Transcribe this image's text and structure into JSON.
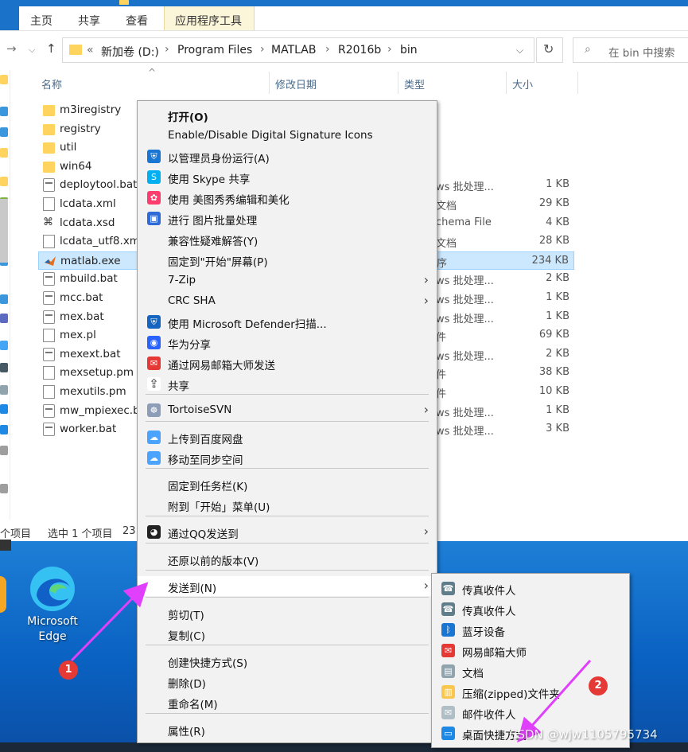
{
  "ribbon": {
    "tabs": [
      "主页",
      "共享",
      "查看"
    ],
    "tools_tab": "应用程序工具"
  },
  "address": {
    "overflow": "«",
    "crumbs": [
      "新加卷 (D:)",
      "Program Files",
      "MATLAB",
      "R2016b",
      "bin"
    ],
    "search_placeholder": "在 bin 中搜索"
  },
  "columns": {
    "name": "名称",
    "date": "修改日期",
    "type": "类型",
    "size": "大小"
  },
  "files": [
    {
      "name": "m3iregistry",
      "type": "",
      "size": "",
      "icon": "folder"
    },
    {
      "name": "registry",
      "type": "",
      "size": "",
      "icon": "folder"
    },
    {
      "name": "util",
      "type": "",
      "size": "",
      "icon": "folder"
    },
    {
      "name": "win64",
      "type": "",
      "size": "",
      "icon": "folder"
    },
    {
      "name": "deploytool.bat",
      "type": "ws 批处理...",
      "size": "1 KB",
      "icon": "bat"
    },
    {
      "name": "lcdata.xml",
      "type": "文档",
      "size": "29 KB",
      "icon": "doc"
    },
    {
      "name": "lcdata.xsd",
      "type": "chema File",
      "size": "4 KB",
      "icon": "xsd"
    },
    {
      "name": "lcdata_utf8.xml",
      "type": "文档",
      "size": "28 KB",
      "icon": "doc"
    },
    {
      "name": "matlab.exe",
      "type": "序",
      "size": "234 KB",
      "icon": "matlab",
      "selected": true
    },
    {
      "name": "mbuild.bat",
      "type": "ws 批处理...",
      "size": "2 KB",
      "icon": "bat"
    },
    {
      "name": "mcc.bat",
      "type": "ws 批处理...",
      "size": "1 KB",
      "icon": "bat"
    },
    {
      "name": "mex.bat",
      "type": "ws 批处理...",
      "size": "1 KB",
      "icon": "bat"
    },
    {
      "name": "mex.pl",
      "type": "件",
      "size": "69 KB",
      "icon": "doc"
    },
    {
      "name": "mexext.bat",
      "type": "ws 批处理...",
      "size": "2 KB",
      "icon": "bat"
    },
    {
      "name": "mexsetup.pm",
      "type": "件",
      "size": "38 KB",
      "icon": "doc"
    },
    {
      "name": "mexutils.pm",
      "type": "件",
      "size": "10 KB",
      "icon": "doc"
    },
    {
      "name": "mw_mpiexec.b",
      "type": "ws 批处理...",
      "size": "1 KB",
      "icon": "bat"
    },
    {
      "name": "worker.bat",
      "type": "ws 批处理...",
      "size": "3 KB",
      "icon": "bat"
    }
  ],
  "status": {
    "count": "个项目",
    "selected": "选中 1 个项目",
    "size_prefix": "23"
  },
  "context_menu": {
    "items": [
      {
        "label": "打开(O)",
        "bold": true
      },
      {
        "label": "Enable/Disable Digital Signature Icons"
      },
      {
        "label": "以管理员身份运行(A)",
        "icon": "shield-icon"
      },
      {
        "label": "使用 Skype 共享",
        "icon": "skype-icon"
      },
      {
        "label": "使用 美图秀秀编辑和美化",
        "icon": "meitu-icon"
      },
      {
        "label": "进行 图片批量处理",
        "icon": "batch-image-icon"
      },
      {
        "label": "兼容性疑难解答(Y)"
      },
      {
        "label": "固定到\"开始\"屏幕(P)"
      },
      {
        "label": "7-Zip",
        "submenu": true
      },
      {
        "label": "CRC SHA",
        "submenu": true
      },
      {
        "label": "使用 Microsoft Defender扫描...",
        "icon": "defender-icon"
      },
      {
        "label": "华为分享",
        "icon": "huawei-share-icon"
      },
      {
        "label": "通过网易邮箱大师发送",
        "icon": "netease-mail-icon"
      },
      {
        "label": "共享",
        "icon": "share-icon"
      },
      {
        "label": "TortoiseSVN",
        "icon": "tortoise-icon",
        "submenu": true
      },
      {
        "label": "上传到百度网盘",
        "icon": "baidu-cloud-icon"
      },
      {
        "label": "移动至同步空间",
        "icon": "baidu-sync-icon"
      },
      {
        "label": "固定到任务栏(K)"
      },
      {
        "label": "附到「开始」菜单(U)"
      },
      {
        "label": "通过QQ发送到",
        "icon": "qq-icon",
        "submenu": true
      },
      {
        "label": "还原以前的版本(V)"
      },
      {
        "label": "发送到(N)",
        "submenu": true,
        "highlighted": true
      },
      {
        "label": "剪切(T)"
      },
      {
        "label": "复制(C)"
      },
      {
        "label": "创建快捷方式(S)"
      },
      {
        "label": "删除(D)"
      },
      {
        "label": "重命名(M)"
      },
      {
        "label": "属性(R)"
      }
    ]
  },
  "send_to_menu": {
    "items": [
      {
        "label": "传真收件人",
        "icon": "fax-icon"
      },
      {
        "label": "传真收件人",
        "icon": "fax-icon"
      },
      {
        "label": "蓝牙设备",
        "icon": "bluetooth-icon"
      },
      {
        "label": "网易邮箱大师",
        "icon": "netease-mail-icon"
      },
      {
        "label": "文档",
        "icon": "document-icon"
      },
      {
        "label": "压缩(zipped)文件夹",
        "icon": "zip-folder-icon"
      },
      {
        "label": "邮件收件人",
        "icon": "mail-icon"
      },
      {
        "label": "桌面快捷方式",
        "icon": "desktop-icon"
      }
    ]
  },
  "desktop": {
    "edge_label_1": "Microsoft",
    "edge_label_2": "Edge"
  },
  "annotations": {
    "badge_1": "1",
    "badge_2": "2",
    "arrow_color": "#e040fb"
  },
  "watermark": "CSDN @wjw1105795734",
  "colors": {
    "accent": "#1a73c8",
    "selection": "#cce8ff",
    "desktop": "#0a62c2"
  }
}
